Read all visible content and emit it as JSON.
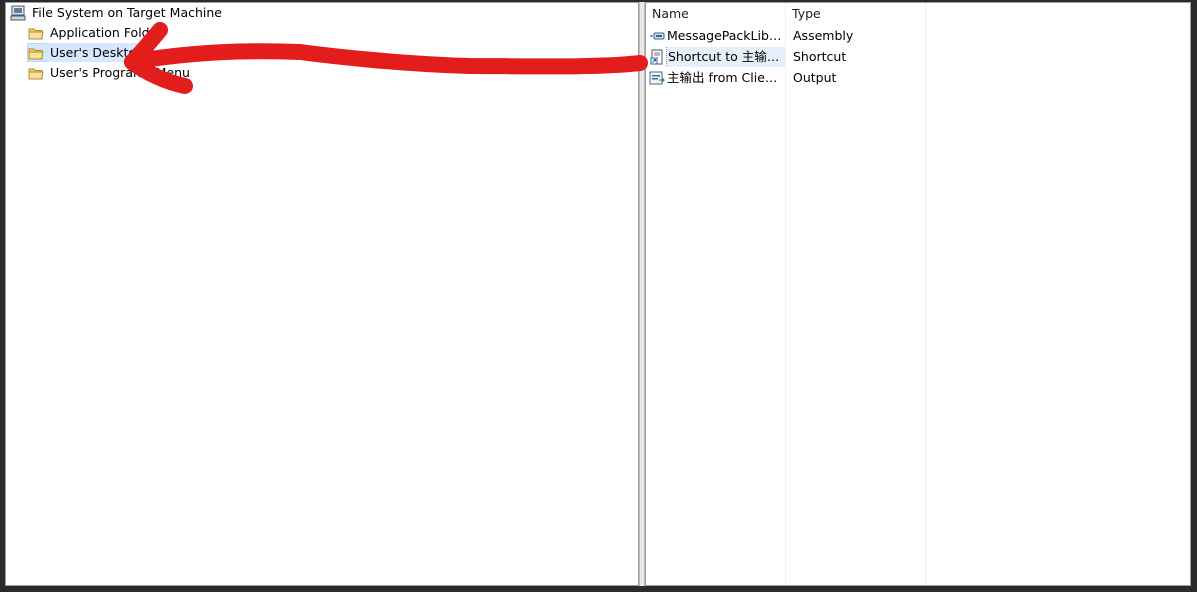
{
  "tree": {
    "root": {
      "label": "File System on Target Machine",
      "icon": "computer-icon"
    },
    "items": [
      {
        "label": "Application Folder",
        "icon": "folder-icon",
        "selected": false
      },
      {
        "label": "User's Desktop",
        "icon": "folder-icon",
        "selected": true
      },
      {
        "label": "User's Programs Menu",
        "icon": "folder-icon",
        "selected": false
      }
    ]
  },
  "list": {
    "columns": [
      "Name",
      "Type"
    ],
    "rows": [
      {
        "name": "MessagePackLib.dll",
        "type": "Assembly",
        "icon": "assembly-icon"
      },
      {
        "name": "Shortcut to 主输出...",
        "type": "Shortcut",
        "icon": "shortcut-icon"
      },
      {
        "name": "主输出 from Client...",
        "type": "Output",
        "icon": "output-icon"
      }
    ]
  },
  "annotation": {
    "color": "#e31c1c",
    "icon": "red-arrow-annotation"
  }
}
